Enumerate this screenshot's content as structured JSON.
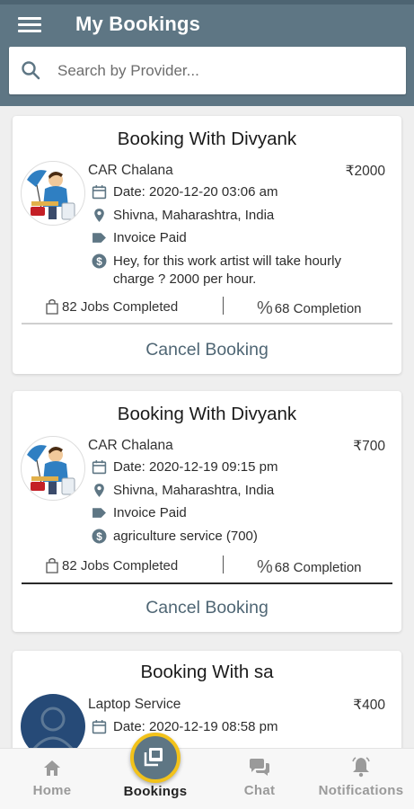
{
  "header": {
    "title": "My Bookings"
  },
  "search": {
    "placeholder": "Search by Provider..."
  },
  "bookings": [
    {
      "title": "Booking With Divyank",
      "service": "CAR Chalana",
      "price": "₹2000",
      "date": "Date: 2020-12-20 03:06 am",
      "location": "Shivna, Maharashtra, India",
      "invoice": "Invoice Paid",
      "note_line1": "Hey, for this work artist will take hourly",
      "note_line2": "charge ? 2000 per hour.",
      "jobs": "82 Jobs Completed",
      "completion": "68 Completion",
      "action": "Cancel Booking"
    },
    {
      "title": "Booking With Divyank",
      "service": "CAR Chalana",
      "price": "₹700",
      "date": "Date: 2020-12-19 09:15 pm",
      "location": "Shivna, Maharashtra, India",
      "invoice": "Invoice Paid",
      "note_line1": "agriculture service (700)",
      "jobs": "82 Jobs Completed",
      "completion": "68 Completion",
      "action": "Cancel Booking"
    },
    {
      "title": "Booking With sa",
      "service": "Laptop Service",
      "price": "₹400",
      "date": "Date: 2020-12-19 08:58 pm"
    }
  ],
  "nav": {
    "items": [
      {
        "label": "Home",
        "icon": "home-icon"
      },
      {
        "label": "Bookings",
        "icon": "bookings-icon"
      },
      {
        "label": "Chat",
        "icon": "chat-icon"
      },
      {
        "label": "Notifications",
        "icon": "bell-icon"
      }
    ],
    "active": "Bookings"
  },
  "colors": {
    "appbar": "#5e7684",
    "accent_ring": "#f2c21a",
    "cancel_text": "#4f6674"
  }
}
